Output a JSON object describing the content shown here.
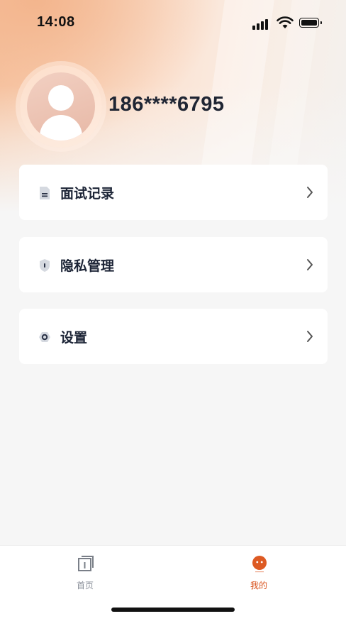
{
  "status_bar": {
    "time": "14:08"
  },
  "profile": {
    "phone": "186****6795"
  },
  "menu": [
    {
      "label": "面试记录",
      "icon": "document-icon"
    },
    {
      "label": "隐私管理",
      "icon": "shield-icon"
    },
    {
      "label": "设置",
      "icon": "gear-icon"
    }
  ],
  "tabbar": {
    "items": [
      {
        "label": "首页",
        "icon": "home-tab-icon",
        "active": false
      },
      {
        "label": "我的",
        "icon": "mine-tab-icon",
        "active": true
      }
    ]
  },
  "colors": {
    "accent": "#d9531e",
    "text_primary": "#1c2436",
    "tab_inactive": "#8a8f99",
    "icon_gray": "#6b7280"
  }
}
